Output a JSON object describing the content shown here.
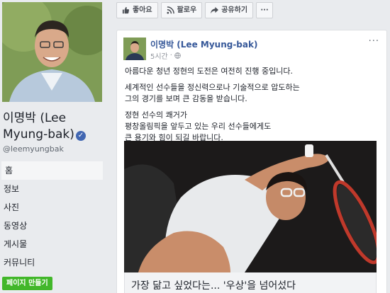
{
  "profile": {
    "name": "이명박 (Lee Myung-bak)",
    "handle": "@leemyungbak",
    "verified_icon": "verified-check-icon"
  },
  "nav": {
    "items": [
      {
        "label": "홈",
        "active": true
      },
      {
        "label": "정보"
      },
      {
        "label": "사진"
      },
      {
        "label": "동영상"
      },
      {
        "label": "게시물"
      },
      {
        "label": "커뮤니티"
      }
    ],
    "create_page_label": "페이지 만들기"
  },
  "actions": {
    "like_label": "좋아요",
    "follow_label": "팔로우",
    "share_label": "공유하기",
    "more_label": "···"
  },
  "post": {
    "author": "이명박 (Lee Myung-bak)",
    "time": "5시간",
    "more_label": "···",
    "paragraphs": [
      "아름다운 청년 정현의 도전은 여전히 진행 중입니다.",
      "세계적인 선수들을 정신력으로나 기술적으로 압도하는",
      "그의 경기를 보며 큰 감동을 받습니다.",
      "정현 선수의 쾌거가",
      "평창올림픽을 앞두고 있는 우리 선수들에게도",
      "큰 용기와 힘이 되길 바랍니다."
    ],
    "link_title": "가장 닮고 싶었다는... '우상'을 넘어섰다"
  },
  "colors": {
    "background": "#e9ebee",
    "link_blue": "#365899",
    "verified_blue": "#4267b2",
    "create_green": "#42b72a"
  }
}
